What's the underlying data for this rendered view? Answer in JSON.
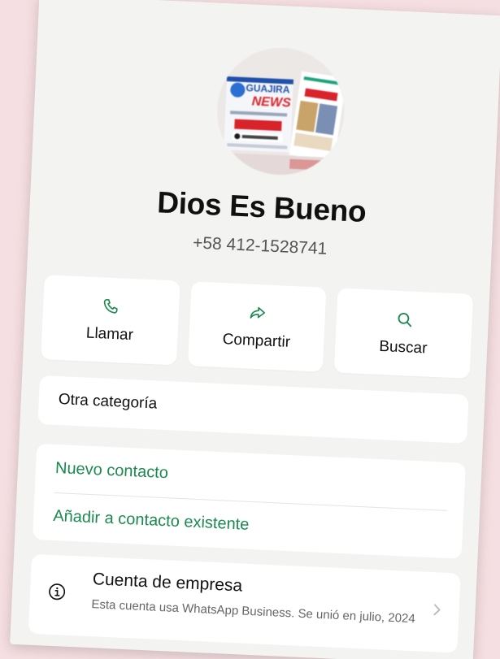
{
  "avatar": {
    "brand_line1": "GUAJIRA",
    "brand_line2": "NEWS",
    "brand_color": "#1f4fa8",
    "accent_color": "#d8232a"
  },
  "contact": {
    "name": "Dios Es Bueno",
    "phone": "+58 412-1528741"
  },
  "actions": {
    "call": {
      "label": "Llamar",
      "icon": "phone-icon"
    },
    "share": {
      "label": "Compartir",
      "icon": "share-arrow-icon"
    },
    "search": {
      "label": "Buscar",
      "icon": "search-icon"
    }
  },
  "category": {
    "label": "Otra categoría"
  },
  "contact_options": {
    "new_contact": "Nuevo contacto",
    "add_existing": "Añadir a contacto existente"
  },
  "business": {
    "title": "Cuenta de empresa",
    "description": "Esta cuenta usa WhatsApp Business. Se unió en julio, 2024"
  },
  "colors": {
    "green_accent": "#1a8a4e",
    "background": "#f3f3f1",
    "page_background": "#f6dfe2"
  }
}
